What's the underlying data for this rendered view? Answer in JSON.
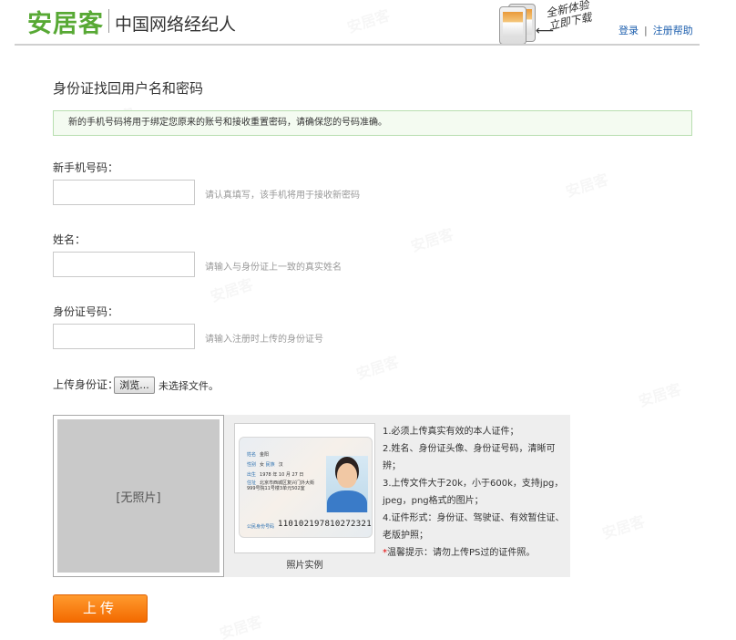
{
  "header": {
    "logo": "安居客",
    "subtitle": "中国网络经纪人",
    "promo_line1": "全新体验",
    "promo_line2": "立即下载",
    "login": "登录",
    "separator": "|",
    "register_help": "注册帮助"
  },
  "watermark": "安居客",
  "page_title": "身份证找回用户名和密码",
  "notice": "新的手机号码将用于绑定您原来的账号和接收重置密码，请确保您的号码准确。",
  "form": {
    "phone": {
      "label": "新手机号码：",
      "value": "",
      "hint": "请认真填写，该手机将用于接收新密码"
    },
    "name": {
      "label": "姓名：",
      "value": "",
      "hint": "请输入与身份证上一致的真实姓名"
    },
    "idnum": {
      "label": "身份证号码：",
      "value": "",
      "hint": "请输入注册时上传的身份证号"
    },
    "upload": {
      "label": "上传身份证：",
      "browse": "浏览...",
      "status": "未选择文件。"
    }
  },
  "preview": {
    "placeholder": "[无照片]",
    "sample_caption": "照片实例",
    "sample_card": {
      "name_label": "姓名",
      "name": "金阳",
      "sex_label": "性别",
      "sex": "女",
      "ethnic_label": "民族",
      "ethnic": "汉",
      "birth_label": "出生",
      "birth": "1978 年 10 月 27 日",
      "address_label": "住址",
      "address": "北京市西城区复兴门外大街999号院11号楼3单元502室",
      "id_label": "公民身份号码",
      "id": "110102197810272321"
    }
  },
  "rules": {
    "r1": "1.必须上传真实有效的本人证件；",
    "r2": "2.姓名、身份证头像、身份证号码，清晰可辨；",
    "r3": "3.上传文件大于20k，小于600k，支持jpg，jpeg，png格式的图片；",
    "r4": "4.证件形式：身份证、驾驶证、有效暂住证、老版护照；",
    "tip_star": "*",
    "tip": "温馨提示：请勿上传PS过的证件照。"
  },
  "submit": "上传",
  "colors": {
    "brand_green": "#58a935",
    "link_blue": "#1d5fae",
    "button_orange": "#f36a00",
    "notice_border": "#b8deb0"
  }
}
